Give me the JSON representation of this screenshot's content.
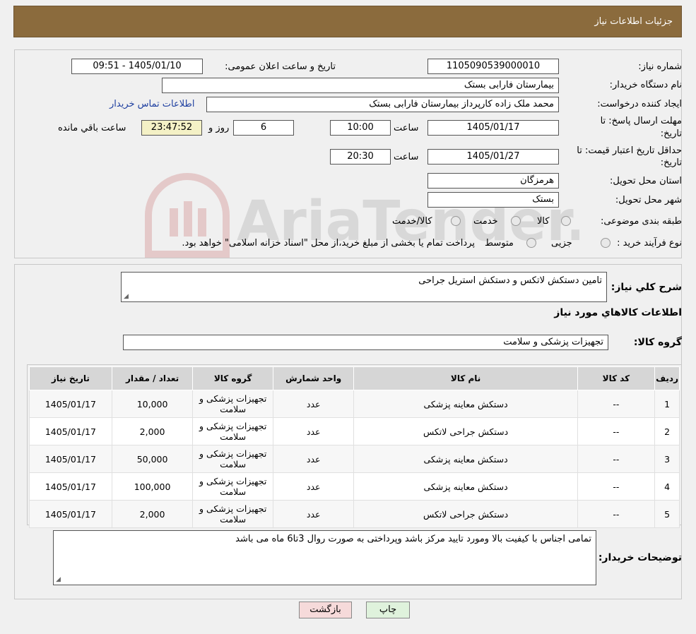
{
  "header": {
    "title": "جزئیات اطلاعات نیاز"
  },
  "form": {
    "need_number_label": "شماره نیاز:",
    "need_number": "1105090539000010",
    "announce_label": "تاریخ و ساعت اعلان عمومی:",
    "announce_value": "1405/01/10 - 09:51",
    "buyer_org_label": "نام دستگاه خریدار:",
    "buyer_org": "بیمارستان فارابی بستک",
    "creator_label": "ایجاد کننده درخواست:",
    "creator": "محمد ملک زاده کارپرداز بیمارستان فارابی بستک",
    "contact_link": "اطلاعات تماس خریدار",
    "deadline_label_1": "مهلت ارسال پاسخ: تا",
    "deadline_label_2": "تاریخ:",
    "deadline_date": "1405/01/17",
    "time_label": "ساعت",
    "deadline_time": "10:00",
    "days": "6",
    "days_label": "روز و",
    "remaining": "23:47:52",
    "remaining_label": "ساعت باقي مانده",
    "validity_label_1": "حداقل تاریخ اعتبار قیمت: تا",
    "validity_label_2": "تاریخ:",
    "validity_date": "1405/01/27",
    "validity_time": "20:30",
    "province_label": "استان محل تحویل:",
    "province": "هرمزگان",
    "city_label": "شهر محل تحویل:",
    "city": "بستک",
    "category_label": "طبقه بندی موضوعی:",
    "category_options": [
      "کالا",
      "خدمت",
      "کالا/خدمت"
    ],
    "process_label": "نوع فرآیند خرید :",
    "process_options": [
      "جزیی",
      "متوسط"
    ],
    "process_note": "پرداخت تمام یا بخشی از مبلغ خرید،از محل \"اسناد خزانه اسلامی\" خواهد بود."
  },
  "details": {
    "summary_label": "شرح کلي نیاز:",
    "summary": "تامین دستکش لاتکس و دستکش استریل جراحی",
    "goods_section_title": "اطلاعات کالاهاي مورد نیاز",
    "group_label": "گروه کالا:",
    "group_value": "تجهیزات پزشکی و سلامت",
    "table": {
      "headers": [
        "ردیف",
        "کد کالا",
        "نام کالا",
        "واحد شمارش",
        "گروه کالا",
        "تعداد / مقدار",
        "تاریخ نیاز"
      ],
      "rows": [
        [
          "1",
          "--",
          "دستکش معاینه پزشکی",
          "عدد",
          "تجهیزات پزشکی و سلامت",
          "10,000",
          "1405/01/17"
        ],
        [
          "2",
          "--",
          "دستکش جراحی لاتکس",
          "عدد",
          "تجهیزات پزشکی و سلامت",
          "2,000",
          "1405/01/17"
        ],
        [
          "3",
          "--",
          "دستکش معاینه پزشکی",
          "عدد",
          "تجهیزات پزشکی و سلامت",
          "50,000",
          "1405/01/17"
        ],
        [
          "4",
          "--",
          "دستکش معاینه پزشکی",
          "عدد",
          "تجهیزات پزشکی و سلامت",
          "100,000",
          "1405/01/17"
        ],
        [
          "5",
          "--",
          "دستکش جراحی لاتکس",
          "عدد",
          "تجهیزات پزشکی و سلامت",
          "2,000",
          "1405/01/17"
        ]
      ]
    },
    "buyer_notes_label": "توضیحات خریدار:",
    "buyer_notes": "تمامی اجناس  با کیفیت بالا ومورد تایید مرکز باشد وپرداختی به صورت روال 3تا6 ماه می باشد"
  },
  "buttons": {
    "print": "چاپ",
    "back": "بازگشت"
  },
  "watermark": {
    "text": "AriaTender.neT"
  },
  "colors": {
    "header_bg": "#8b6b3d",
    "link": "#1e3fa0",
    "back_button_bg": "#f6dada",
    "print_button_bg": "#dff2dc"
  }
}
